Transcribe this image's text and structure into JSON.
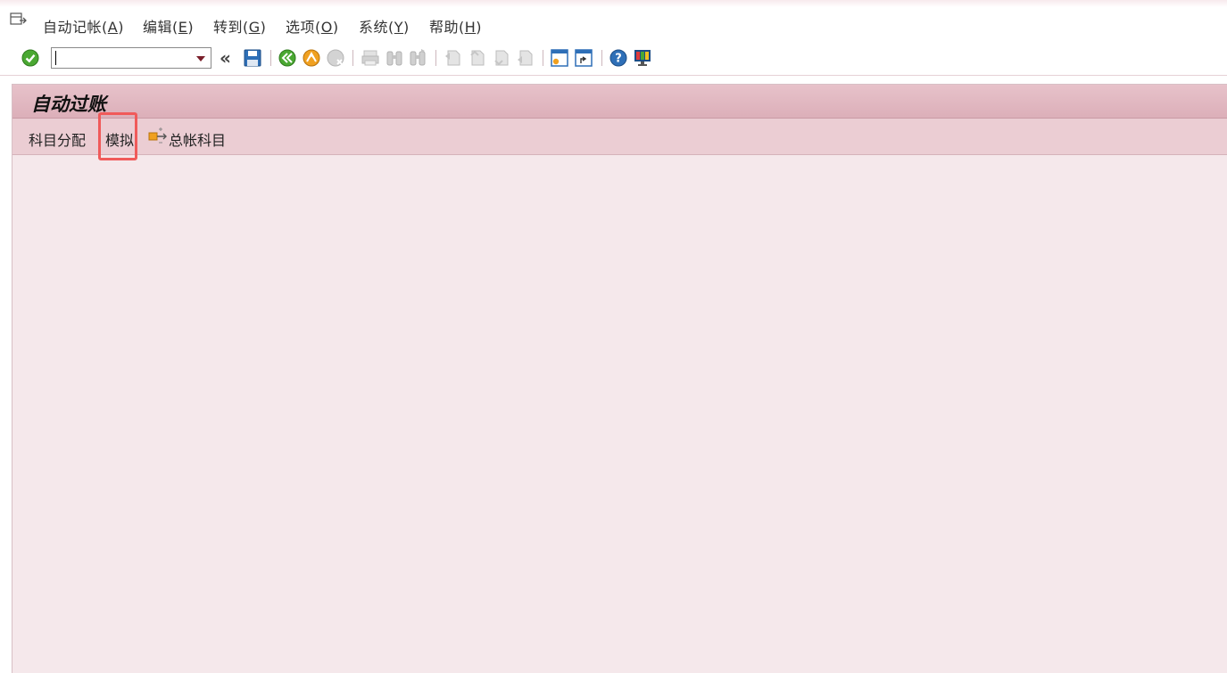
{
  "menu": {
    "items": [
      {
        "pre": "自动记帐(",
        "key": "A",
        "post": ")"
      },
      {
        "pre": "编辑(",
        "key": "E",
        "post": ")"
      },
      {
        "pre": "转到(",
        "key": "G",
        "post": ")"
      },
      {
        "pre": "选项(",
        "key": "O",
        "post": ")"
      },
      {
        "pre": "系统(",
        "key": "Y",
        "post": ")"
      },
      {
        "pre": "帮助(",
        "key": "H",
        "post": ")"
      }
    ]
  },
  "toolbar": {
    "command_field": {
      "value": "",
      "placeholder": ""
    },
    "back_arrows": "«"
  },
  "screen": {
    "title": "自动过账",
    "app_toolbar": {
      "account_assignment": "科目分配",
      "simulate": "模拟",
      "gl_accounts": "总帐科目"
    }
  },
  "colors": {
    "accent": "#7a1f2a",
    "highlight": "#f05a5a",
    "title_bar": "#dcafb9",
    "screen_bg": "#f5e8eb"
  }
}
